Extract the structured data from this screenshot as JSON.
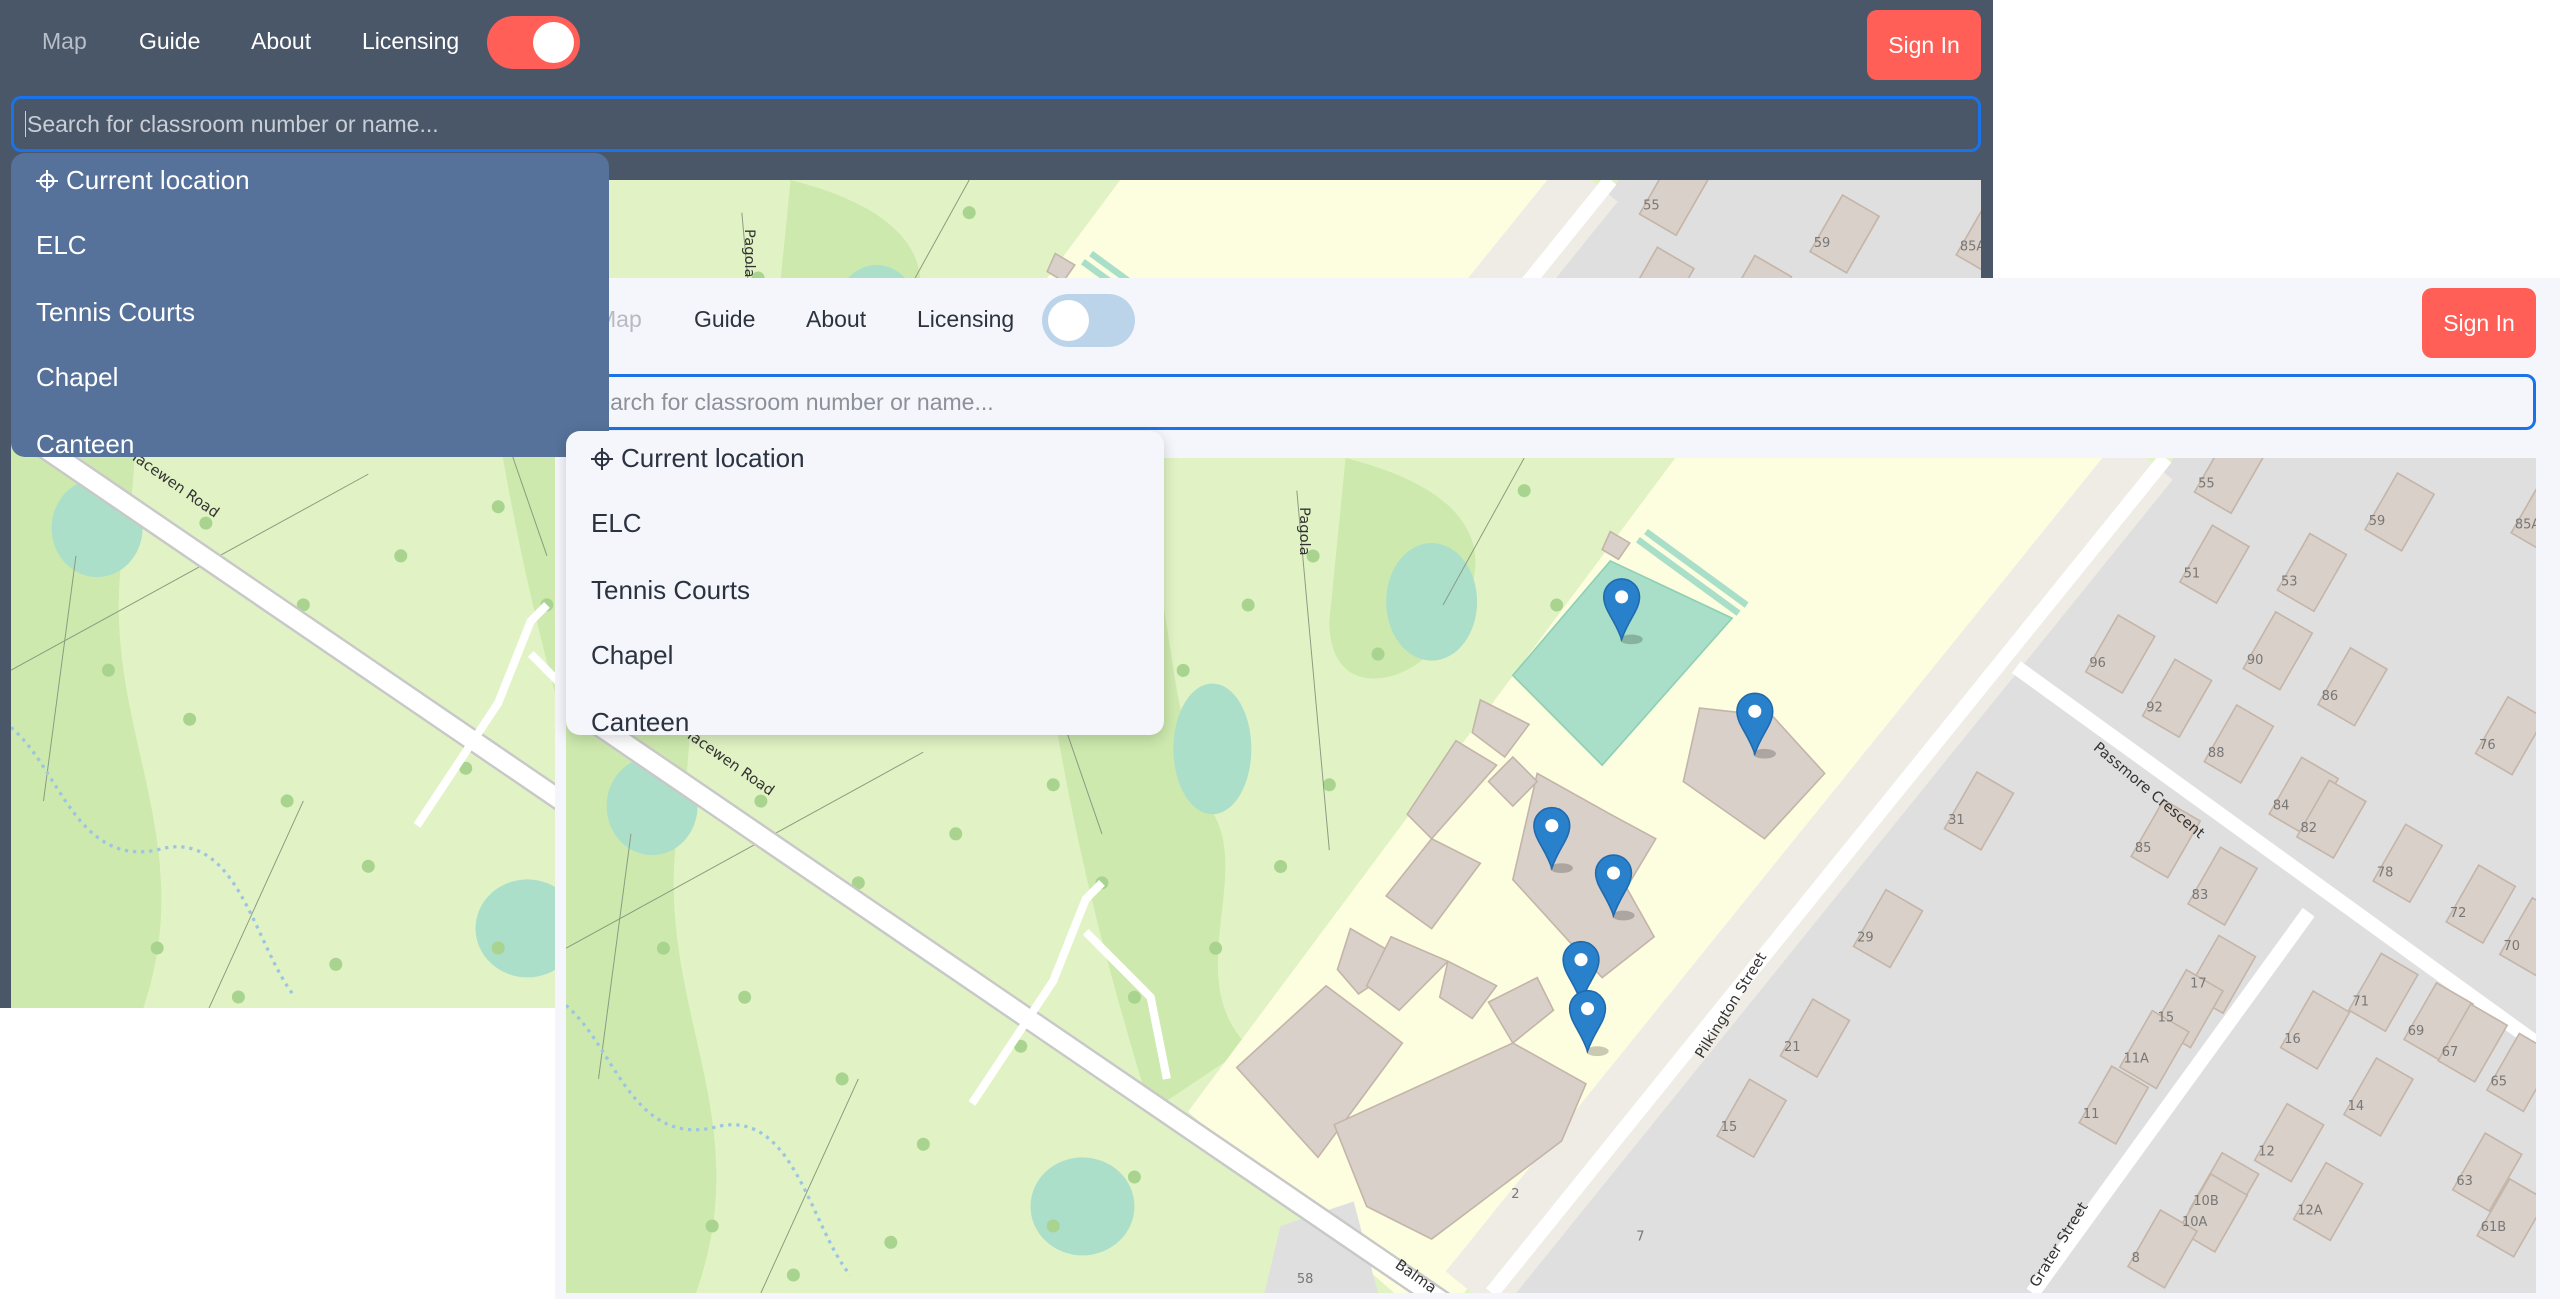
{
  "nav": {
    "items": [
      {
        "label": "Map"
      },
      {
        "label": "Guide"
      },
      {
        "label": "About"
      },
      {
        "label": "Licensing"
      }
    ],
    "sign_in": "Sign In"
  },
  "theme_toggle": {
    "dark_window": "on",
    "light_window": "off"
  },
  "search": {
    "placeholder": "Search for classroom number or name...",
    "value": ""
  },
  "dropdown": {
    "items": [
      {
        "label": "Current location",
        "icon": "crosshair-icon"
      },
      {
        "label": "ELC"
      },
      {
        "label": "Tennis Courts"
      },
      {
        "label": "Chapel"
      },
      {
        "label": "Canteen"
      }
    ]
  },
  "map": {
    "streets": [
      "Pagola",
      "Macewen Road",
      "Pilkington Street",
      "Passmore Crescent",
      "Grater Street",
      "Balma"
    ],
    "house_numbers": [
      "55",
      "59",
      "85A",
      "51",
      "53",
      "96",
      "90",
      "92",
      "86",
      "76",
      "88",
      "84",
      "82",
      "78",
      "72",
      "70",
      "31",
      "85",
      "83",
      "29",
      "17",
      "15",
      "21",
      "16",
      "71",
      "69",
      "67",
      "65",
      "11A",
      "14",
      "11",
      "15",
      "12",
      "63",
      "10B",
      "12A",
      "10A",
      "61B",
      "7",
      "8",
      "2",
      "58"
    ],
    "markers": 6
  },
  "colors": {
    "accent": "#ff5f57",
    "dark_header": "#4a5768",
    "dark_dropdown": "#56729a",
    "light_header": "#f5f6fc",
    "focus_border": "#1a73e8",
    "marker": "#2a81cb"
  }
}
